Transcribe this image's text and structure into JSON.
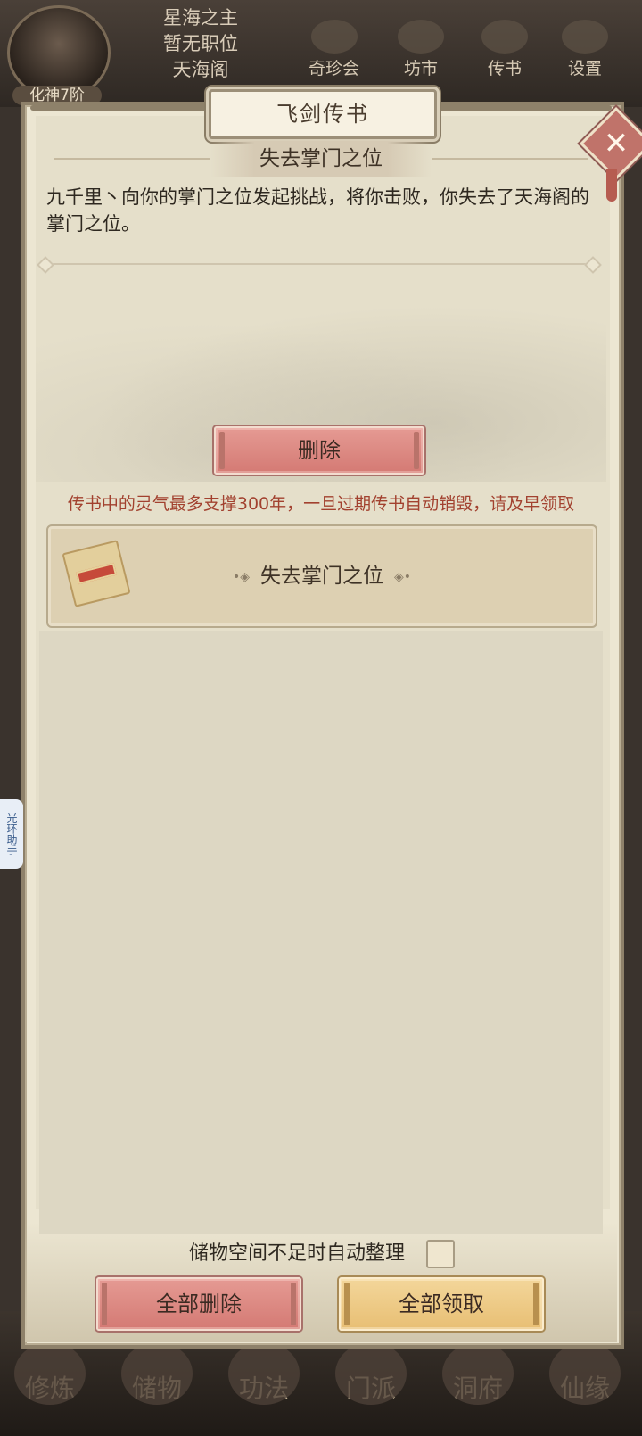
{
  "player": {
    "name": "星海之主",
    "position": "暂无职位",
    "sect": "天海阁",
    "realm": "化神7阶"
  },
  "top_nav": [
    {
      "label": "奇珍会",
      "icon": "treasure-pavilion-icon"
    },
    {
      "label": "坊市",
      "icon": "market-icon"
    },
    {
      "label": "传书",
      "icon": "letter-icon"
    },
    {
      "label": "设置",
      "icon": "gear-icon"
    }
  ],
  "bottom_nav": [
    {
      "label": "修炼",
      "icon": "cultivate-icon"
    },
    {
      "label": "储物",
      "icon": "storage-icon"
    },
    {
      "label": "功法",
      "icon": "technique-icon"
    },
    {
      "label": "门派",
      "icon": "sect-icon"
    },
    {
      "label": "洞府",
      "icon": "cave-icon"
    },
    {
      "label": "仙缘",
      "icon": "fate-icon"
    }
  ],
  "side_helper": "光环助手",
  "dialog": {
    "title": "飞剑传书",
    "close_icon": "close-icon",
    "message": {
      "title": "失去掌门之位",
      "body": "九千里丶向你的掌门之位发起挑战，将你击败，你失去了天海阁的掌门之位。",
      "delete_label": "删除"
    },
    "notice": "传书中的灵气最多支撑300年，一旦过期传书自动销毁，请及早领取",
    "mail_list": [
      {
        "title": "失去掌门之位",
        "icon": "scroll-letter-icon"
      }
    ],
    "auto_sort_label": "储物空间不足时自动整理",
    "auto_sort_checked": false,
    "delete_all_label": "全部删除",
    "claim_all_label": "全部领取"
  },
  "colors": {
    "accent_red": "#d47a74",
    "accent_gold": "#e8bf74",
    "notice_red": "#a2412f",
    "paper": "#ece6d2"
  }
}
